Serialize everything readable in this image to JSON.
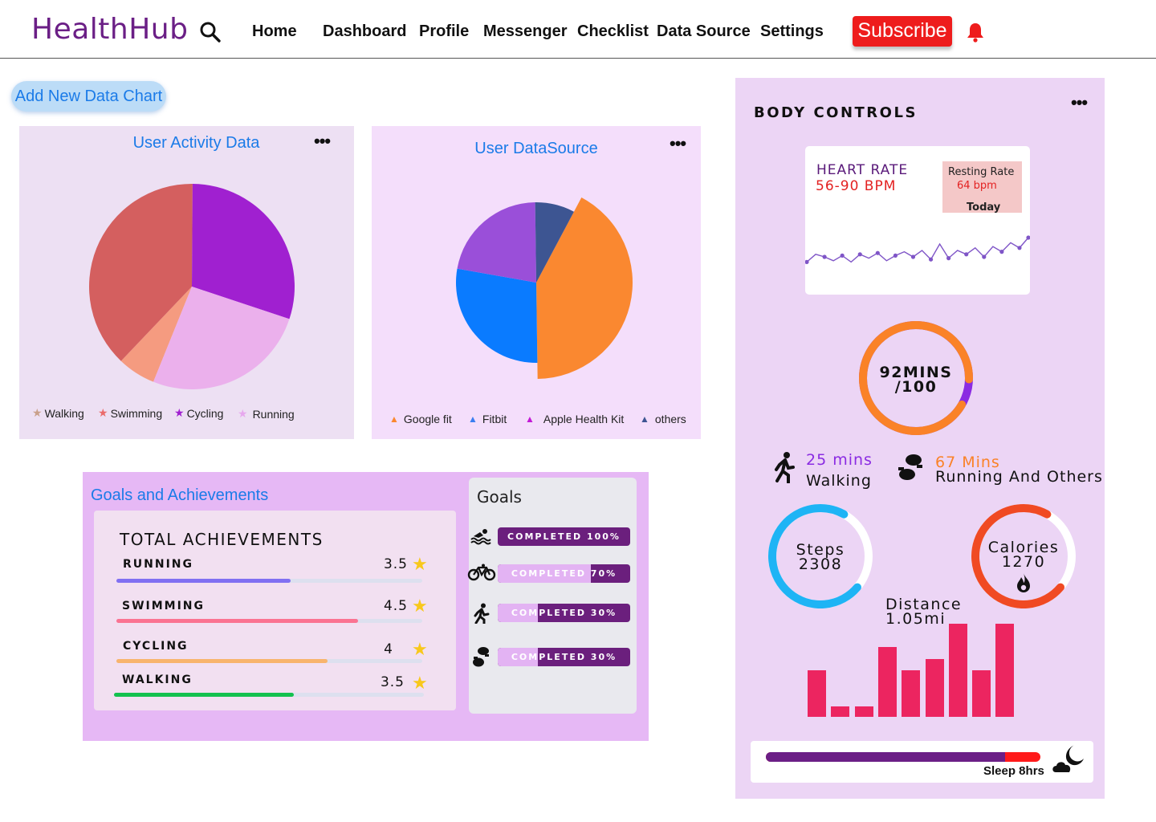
{
  "header": {
    "logo": "HealthHub",
    "nav": [
      "Home",
      "Dashboard",
      "Profile",
      "Messenger",
      "Checklist",
      "Data Source",
      "Settings"
    ],
    "subscribe_label": "Subscribe"
  },
  "toolbar": {
    "add_chart_label": "Add New Data Chart"
  },
  "activity_chart": {
    "title": "User Activity Data",
    "menu": "•••",
    "legend": [
      "Walking",
      "Swimming",
      "Cycling",
      "Running"
    ]
  },
  "source_chart": {
    "title": "User DataSource",
    "menu": "•••",
    "legend": [
      "Google fit",
      "Fitbit",
      "Apple Health Kit",
      "others"
    ]
  },
  "chart_data": [
    {
      "type": "pie",
      "title": "User Activity Data",
      "series": [
        {
          "name": "Walking",
          "value": 6,
          "color": "#f59b80"
        },
        {
          "name": "Swimming",
          "value": 38,
          "color": "#d45f5f"
        },
        {
          "name": "Cycling",
          "value": 30,
          "color": "#a020d0"
        },
        {
          "name": "Running",
          "value": 26,
          "color": "#ebb0ec"
        }
      ],
      "legend_colors": [
        "#c9a08a",
        "#ea6b6b",
        "#a020d0",
        "#e7a8ee"
      ]
    },
    {
      "type": "pie",
      "title": "User DataSource",
      "series": [
        {
          "name": "Google fit",
          "value": 42,
          "color": "#fa8830"
        },
        {
          "name": "Fitbit",
          "value": 28,
          "color": "#0a7bff"
        },
        {
          "name": "Apple Health Kit",
          "value": 22,
          "color": "#9a4fd9"
        },
        {
          "name": "others",
          "value": 8,
          "color": "#3d5592"
        }
      ],
      "legend_colors": [
        "#fa8830",
        "#3a7ef0",
        "#c21ad6",
        "#3d5592"
      ]
    },
    {
      "type": "line",
      "title": "HEART RATE",
      "values": [
        66,
        72,
        70,
        67,
        71,
        66,
        72,
        69,
        73,
        67,
        71,
        74,
        70,
        75,
        68,
        80,
        69,
        75,
        72,
        77,
        70,
        78,
        74,
        81,
        77,
        85
      ]
    },
    {
      "type": "bar",
      "title": "Distance",
      "values": [
        52,
        12,
        12,
        78,
        52,
        65,
        104,
        52,
        104
      ]
    }
  ],
  "goals": {
    "title": "Goals and Achievements",
    "achievements_heading": "TOTAL ACHIEVEMENTS",
    "achievements": [
      {
        "label": "RUNNING",
        "value": "3.5",
        "progress": 0.57,
        "color": "#8170f2"
      },
      {
        "label": "SWIMMING",
        "value": "4.5",
        "progress": 0.79,
        "color": "#fb7392"
      },
      {
        "label": "CYCLING",
        "value": "4",
        "progress": 0.69,
        "color": "#f8b46d"
      },
      {
        "label": "WALKING",
        "value": "3.5",
        "progress": 0.58,
        "color": "#14c14f"
      }
    ],
    "star": "★",
    "goals_heading": "Goals",
    "goal_items": [
      {
        "icon": "swimming-icon",
        "text": "COMPLETED 100%",
        "progress": 1.0
      },
      {
        "icon": "cycling-icon",
        "text": "COMPLETED 70%",
        "progress": 0.7
      },
      {
        "icon": "walking-icon",
        "text": "COMPLETED 30%",
        "progress": 0.3
      },
      {
        "icon": "footprints-icon",
        "text": "COMPLETED 30%",
        "progress": 0.3
      }
    ]
  },
  "body_controls": {
    "title": "BODY CONTROLS",
    "menu": "•••",
    "heart_rate": {
      "title": "HEART RATE",
      "range": "56-90 BPM",
      "resting_title": "Resting Rate",
      "resting_value": "64 bpm",
      "resting_day": "Today"
    },
    "activity_ring": {
      "line1": "92MINS",
      "line2": "/100",
      "progress": 0.92
    },
    "walking": {
      "value": "25 mins",
      "label": "Walking"
    },
    "running": {
      "value": "67 Mins",
      "label": "Running And Others"
    },
    "steps": {
      "label": "Steps",
      "value": "2308",
      "progress": 0.72
    },
    "calories": {
      "label": "Calories",
      "value": "1270",
      "progress": 0.72
    },
    "distance": {
      "label": "Distance",
      "value": "1.05mi"
    },
    "sleep": {
      "label": "Sleep 8hrs",
      "progress": 0.87
    },
    "colors": {
      "accent_purple": "#8a2be2",
      "accent_orange": "#fa8228",
      "steps_blue": "#1eb4f5",
      "calories_red": "#f04a23"
    }
  }
}
